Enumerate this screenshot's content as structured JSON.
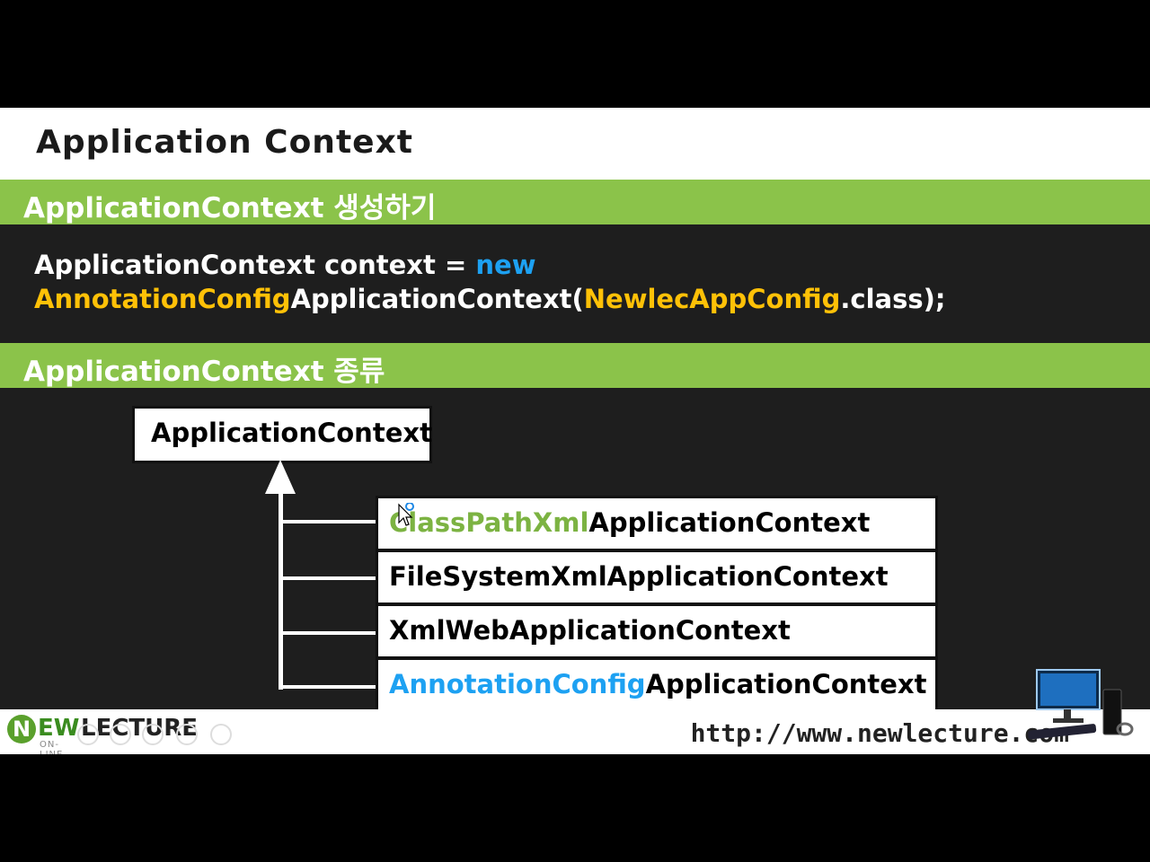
{
  "slide": {
    "title": "Application Context",
    "section1": "ApplicationContext 생성하기",
    "code": {
      "line1_prefix": "ApplicationContext context = ",
      "line1_keyword": "new",
      "line2_class_highlight": "AnnotationConfig",
      "line2_class_rest": "ApplicationContext(",
      "line2_arg_highlight": "NewlecAppConfig",
      "line2_suffix": ".class);"
    },
    "section2": "ApplicationContext 종류",
    "diagram": {
      "root": "ApplicationContext",
      "children": [
        {
          "highlight": "ClassPathXml",
          "rest": "ApplicationContext",
          "highlight_color": "#7cb342"
        },
        {
          "highlight": "",
          "rest": "FileSystemXmlApplicationContext",
          "highlight_color": ""
        },
        {
          "highlight": "",
          "rest": "XmlWebApplicationContext",
          "highlight_color": ""
        },
        {
          "highlight": "AnnotationConfig",
          "rest": "ApplicationContext",
          "highlight_color": "#1da1f2"
        }
      ]
    }
  },
  "footer": {
    "logo_n": "N",
    "logo_ew": "EW",
    "logo_lecture": "LECTURE",
    "logo_online": "ON-LINE",
    "url": "http://www.newlecture.com"
  },
  "colors": {
    "section_green": "#8bc34a",
    "keyword_blue": "#1da1f2",
    "keyword_yellow": "#ffc107"
  }
}
